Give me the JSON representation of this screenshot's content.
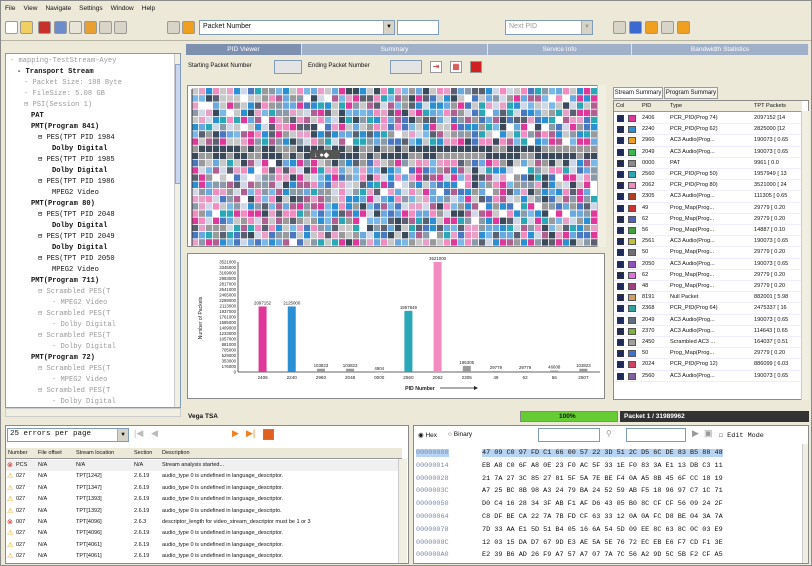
{
  "menu": [
    "File",
    "View",
    "Navigate",
    "Settings",
    "Window",
    "Help"
  ],
  "toolbar": {
    "packet_selector": "Packet Number",
    "search_placeholder": "",
    "filter_value": "Next PID"
  },
  "tree": {
    "nodes": [
      {
        "text": "- mapping-TestStream-Ayey",
        "indent": 0,
        "style": "grey"
      },
      {
        "text": "- Transport Stream",
        "indent": 1,
        "style": "bold"
      },
      {
        "text": "- Packet Size: 188 Byte",
        "indent": 2,
        "style": "grey"
      },
      {
        "text": "- FileSize: 5.08 GB",
        "indent": 2,
        "style": "grey"
      },
      {
        "text": "⊟ PSI(Session 1)",
        "indent": 2,
        "style": "grey"
      },
      {
        "text": "PAT",
        "indent": 3,
        "style": "bold"
      },
      {
        "text": "PMT(Program 841)",
        "indent": 3,
        "style": "bold"
      },
      {
        "text": "⊟ PES(TPT PID 1984",
        "indent": 4,
        "style": "normal"
      },
      {
        "text": "Dolby Digital",
        "indent": 6,
        "style": "bold"
      },
      {
        "text": "⊟ PES(TPT PID 1985",
        "indent": 4,
        "style": "normal"
      },
      {
        "text": "Dolby Digital",
        "indent": 6,
        "style": "bold"
      },
      {
        "text": "⊟ PES(TPT PID 1986",
        "indent": 4,
        "style": "normal"
      },
      {
        "text": "MPEG2 Video",
        "indent": 6,
        "style": "normal"
      },
      {
        "text": "PMT(Program 80)",
        "indent": 3,
        "style": "bold"
      },
      {
        "text": "⊟ PES(TPT PID 2048",
        "indent": 4,
        "style": "normal"
      },
      {
        "text": "Dolby Digital",
        "indent": 6,
        "style": "bold"
      },
      {
        "text": "⊟ PES(TPT PID 2049",
        "indent": 4,
        "style": "normal"
      },
      {
        "text": "Dolby Digital",
        "indent": 6,
        "style": "bold"
      },
      {
        "text": "⊟ PES(TPT PID 2050",
        "indent": 4,
        "style": "normal"
      },
      {
        "text": "MPEG2 Video",
        "indent": 6,
        "style": "normal"
      },
      {
        "text": "PMT(Program 711)",
        "indent": 3,
        "style": "bold"
      },
      {
        "text": "⊟ Scrambled PES(T",
        "indent": 4,
        "style": "grey"
      },
      {
        "text": "- MPEG2 Video",
        "indent": 6,
        "style": "grey"
      },
      {
        "text": "⊟ Scrambled PES(T",
        "indent": 4,
        "style": "grey"
      },
      {
        "text": "- Dolby Digital",
        "indent": 6,
        "style": "grey"
      },
      {
        "text": "⊟ Scrambled PES(T",
        "indent": 4,
        "style": "grey"
      },
      {
        "text": "- Dolby Digital",
        "indent": 6,
        "style": "grey"
      },
      {
        "text": "PMT(Program 72)",
        "indent": 3,
        "style": "bold"
      },
      {
        "text": "⊟ Scrambled PES(T",
        "indent": 4,
        "style": "grey"
      },
      {
        "text": "- MPEG2 Video",
        "indent": 6,
        "style": "grey"
      },
      {
        "text": "⊟ Scrambled PES(T",
        "indent": 4,
        "style": "grey"
      },
      {
        "text": "- Dolby Digital",
        "indent": 6,
        "style": "grey"
      }
    ]
  },
  "tabs": [
    "PID Viewer",
    "Summary",
    "Service Info",
    "Bandwidth Statistics"
  ],
  "packet_range": {
    "start_label": "Starting Packet Number",
    "end_label": "Ending Packet Number"
  },
  "chart_data": {
    "type": "bar",
    "xlabel": "PID Number",
    "ylabel": "Number of Packets",
    "categories": [
      "2406",
      "2240",
      "2960",
      "2048",
      "0000",
      "2560",
      "2062",
      "2305",
      "49",
      "62",
      "56",
      "2507"
    ],
    "values": [
      2097152,
      2097152,
      103823,
      103823,
      1,
      1957949,
      3521000,
      195350,
      29779,
      29779,
      46608,
      103823
    ],
    "data_labels": [
      "2097152",
      "2125000",
      "103823",
      "103823",
      "4904",
      "1957949",
      "3521000",
      "195305",
      "29779",
      "29779",
      "46608",
      "103823"
    ],
    "colors": [
      "#e0389a",
      "#2a8fd3",
      "#9a9a9a",
      "#9a9a9a",
      "#9a9a9a",
      "#2aa8b8",
      "#f28cc0",
      "#9a9a9a",
      "#9a9a9a",
      "#9a9a9a",
      "#9a9a9a",
      "#9a9a9a"
    ],
    "yticks": [
      "3521000",
      "3345000",
      "3169000",
      "2993000",
      "2817000",
      "2641000",
      "2465000",
      "2289000",
      "2113000",
      "1937000",
      "1761000",
      "1585000",
      "1409000",
      "1233000",
      "1057000",
      "881000",
      "705000",
      "529000",
      "353000",
      "176000",
      "0"
    ],
    "ylim": [
      0,
      3521000
    ]
  },
  "stream_summary": {
    "tabs": [
      "Stream Summary",
      "Program Summary"
    ],
    "headers": [
      "Col",
      "PID",
      "Type",
      "TPT Packets"
    ],
    "rows": [
      {
        "color": "#e0389a",
        "pid": "2406",
        "type": "PCR_PID(Prog 74)",
        "count": "2097152 [14"
      },
      {
        "color": "#2a8fd3",
        "pid": "2240",
        "type": "PCR_PID(Prog 62)",
        "count": "2825000 [12"
      },
      {
        "color": "#f0a020",
        "pid": "2960",
        "type": "AC3 Audio(Prog...",
        "count": "190073 [ 0.65"
      },
      {
        "color": "#3cb850",
        "pid": "2049",
        "type": "AC3 Audio(Prog...",
        "count": "190073 [ 0.65"
      },
      {
        "color": "#8a8a8a",
        "pid": "0000",
        "type": "PAT",
        "count": "9961 [ 0.0"
      },
      {
        "color": "#2aa8b8",
        "pid": "2560",
        "type": "PCR_PID(Prog 50)",
        "count": "1957949 [ 13"
      },
      {
        "color": "#f28cc0",
        "pid": "2062",
        "type": "PCR_PID(Prog 80)",
        "count": "3521000 [ 24"
      },
      {
        "color": "#b04020",
        "pid": "2305",
        "type": "AC3 Audio(Prog...",
        "count": "111305 [ 0.65"
      },
      {
        "color": "#d03030",
        "pid": "49",
        "type": "Prog_Map(Prog...",
        "count": "29779 [ 0.20"
      },
      {
        "color": "#5060c0",
        "pid": "62",
        "type": "Prog_Map(Prog...",
        "count": "29779 [ 0.20"
      },
      {
        "color": "#40a040",
        "pid": "56",
        "type": "Prog_Map(Prog...",
        "count": "14887 [ 0.10"
      },
      {
        "color": "#c0c040",
        "pid": "2561",
        "type": "AC3 Audio(Prog...",
        "count": "190073 [ 0.65"
      },
      {
        "color": "#707070",
        "pid": "50",
        "type": "Prog_Map(Prog...",
        "count": "29779 [ 0.20"
      },
      {
        "color": "#9050c0",
        "pid": "2050",
        "type": "AC3 Audio(Prog...",
        "count": "190073 [ 0.65"
      },
      {
        "color": "#e070e0",
        "pid": "62",
        "type": "Prog_Map(Prog...",
        "count": "29779 [ 0.20"
      },
      {
        "color": "#a04080",
        "pid": "48",
        "type": "Prog_Map(Prog...",
        "count": "29779 [ 0.20"
      },
      {
        "color": "#d0a060",
        "pid": "8191",
        "type": "Null Packet",
        "count": "882001 [ 5.98"
      },
      {
        "color": "#30a0a0",
        "pid": "2368",
        "type": "PCR_PID(Prog 64)",
        "count": "2475337 [ 16"
      },
      {
        "color": "#607080",
        "pid": "2049",
        "type": "AC3 Audio(Prog...",
        "count": "190073 [ 0.65"
      },
      {
        "color": "#80b040",
        "pid": "2370",
        "type": "AC3 Audio(Prog...",
        "count": "114643 [ 0.65"
      },
      {
        "color": "#a0a0a0",
        "pid": "2450",
        "type": "Scrambled AC3 ...",
        "count": "164037 [ 0.51"
      },
      {
        "color": "#4070d0",
        "pid": "50",
        "type": "Prog_Map(Prog...",
        "count": "29779 [ 0.20"
      },
      {
        "color": "#d04060",
        "pid": "2024",
        "type": "PCR_PID(Prog 12)",
        "count": "886099 [ 6.03"
      },
      {
        "color": "#8060a0",
        "pid": "2560",
        "type": "AC3 Audio(Prog...",
        "count": "190073 [ 0.65"
      }
    ]
  },
  "status": {
    "stream": "Vega TSA",
    "progress_text": "100%",
    "progress_fraction": 1.0,
    "packet_info": "Packet 1 / 31989962"
  },
  "errors": {
    "per_page": "25 errors per page",
    "headers": [
      "Number",
      "File offset",
      "Stream location",
      "Section",
      "Description"
    ],
    "rows": [
      {
        "icon": "error",
        "num": "PCS",
        "offset": "N/A",
        "loc": "N/A",
        "section": "N/A",
        "desc": "Stream analysis started..."
      },
      {
        "icon": "warn",
        "num": "027",
        "offset": "N/A",
        "loc": "TPT[1242]",
        "section": "2.6.19",
        "desc": "audio_type 0 is undefined in language_descriptor."
      },
      {
        "icon": "warn",
        "num": "027",
        "offset": "N/A",
        "loc": "TPT[1347]",
        "section": "2.6.19",
        "desc": "audio_type 0 is undefined in language_descriptor."
      },
      {
        "icon": "warn",
        "num": "027",
        "offset": "N/A",
        "loc": "TPT[1393]",
        "section": "2.6.19",
        "desc": "audio_type 0 is undefined in language_descriptor."
      },
      {
        "icon": "warn",
        "num": "027",
        "offset": "N/A",
        "loc": "TPT[1392]",
        "section": "2.6.19",
        "desc": "audio_type 0 is undefined in language_descripto."
      },
      {
        "icon": "error",
        "num": "007",
        "offset": "N/A",
        "loc": "TPT[4096]",
        "section": "2.6.3",
        "desc": "descriptor_length for video_stream_descriptor must be 1 or 3"
      },
      {
        "icon": "warn",
        "num": "027",
        "offset": "N/A",
        "loc": "TPT[4096]",
        "section": "2.6.19",
        "desc": "audio_type 0 is undefined in language_descriptor."
      },
      {
        "icon": "warn",
        "num": "027",
        "offset": "N/A",
        "loc": "TPT[4061]",
        "section": "2.6.19",
        "desc": "audio_type 0 is undefined in language_descriptor."
      },
      {
        "icon": "warn",
        "num": "027",
        "offset": "N/A",
        "loc": "TPT[4061]",
        "section": "2.6.19",
        "desc": "audio_type 0 is undefined in language_descriptor."
      }
    ]
  },
  "hex": {
    "mode_hex": "Hex",
    "mode_binary": "Binary",
    "edit_mode": "Edit Mode",
    "rows": [
      {
        "addr": "00000000",
        "bytes": "47 09 C0 97 FD C1 66 00 57 22 3D 51 2C D5 6C DE 83 B5 88 48",
        "selected": true
      },
      {
        "addr": "00000014",
        "bytes": "EB A8 C0 6F A8 0E 23 F0 AC 5F 33 1E F0 83 3A E1 13 DB C3 11",
        "selected": false
      },
      {
        "addr": "00000028",
        "bytes": "21 7A 27 3C 85 27 81 5F 5A 7E BE F4 0A A5 8B 45 6F CC 18 19",
        "selected": false
      },
      {
        "addr": "0000003C",
        "bytes": "A7 25 BC 8B 98 A3 24 79 BA 24 52 59 AB F5 18 96 97 C7 1C 71",
        "selected": false
      },
      {
        "addr": "00000050",
        "bytes": "D0 C4 16 28 34 3F AB F1 AF D6 43 05 B0 8C CF CF 56 09 24 2F",
        "selected": false
      },
      {
        "addr": "00000064",
        "bytes": "C8 DF BE CA 22 7A 7B FD CF 63 33 12 0A 0A FC D8 BE 04 3A 7A",
        "selected": false
      },
      {
        "addr": "00000078",
        "bytes": "7D 33 AA E1 5D 51 B4 05 16 6A 54 5D 09 EE 8C 63 8C 0C 03 E9",
        "selected": false
      },
      {
        "addr": "0000008C",
        "bytes": "12 03 15 DA D7 67 9D E3 AE 5A 5E 76 72 EC EB E6 F7 CD F1 3E",
        "selected": false
      },
      {
        "addr": "000000A0",
        "bytes": "E2 39 B6 AD 26 F9 A7 57 A7 07 7A 7C 56 A2 9D 5C 5B F2 CF A5",
        "selected": false
      }
    ]
  },
  "icons": [
    "new-icon",
    "open-icon",
    "filter-icon",
    "find-icon",
    "bookmark-icon",
    "map-icon",
    "prev-icon",
    "next-icon",
    "grid-icon",
    "stop-icon",
    "first-page-icon",
    "prev-page-icon",
    "next-page-icon",
    "last-page-icon",
    "export-icon",
    "warning-icon",
    "error-icon"
  ],
  "colors": {
    "progress": "#66cc33",
    "tab": "#9fb0c8",
    "tab_active": "#7d90b0",
    "hex_selected": "#b8d4f4",
    "packet_label": "#fff"
  }
}
